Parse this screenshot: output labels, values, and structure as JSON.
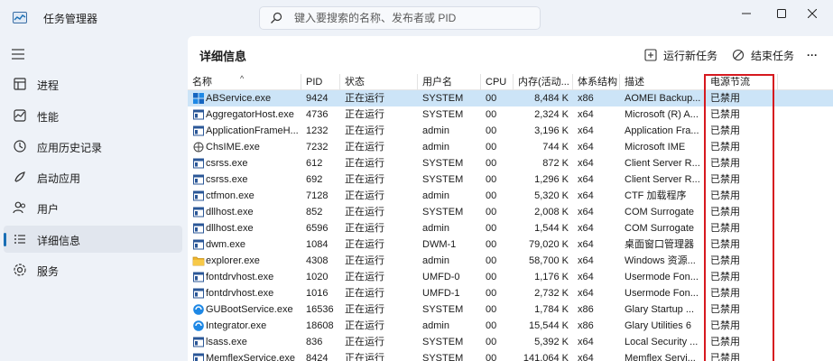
{
  "app": {
    "title": "任务管理器"
  },
  "search": {
    "placeholder": "键入要搜索的名称、发布者或 PID"
  },
  "sidebar": {
    "items": [
      {
        "label": "进程",
        "icon": "processes-icon"
      },
      {
        "label": "性能",
        "icon": "performance-icon"
      },
      {
        "label": "应用历史记录",
        "icon": "app-history-icon"
      },
      {
        "label": "启动应用",
        "icon": "startup-apps-icon"
      },
      {
        "label": "用户",
        "icon": "users-icon"
      },
      {
        "label": "详细信息",
        "icon": "details-icon",
        "active": true
      },
      {
        "label": "服务",
        "icon": "services-icon"
      }
    ]
  },
  "main": {
    "title": "详细信息",
    "run_new_task": "运行新任务",
    "end_task": "结束任务",
    "more": "···"
  },
  "table": {
    "columns": [
      "名称",
      "PID",
      "状态",
      "用户名",
      "CPU",
      "内存(活动...",
      "体系结构",
      "描述",
      "电源节流"
    ],
    "rows": [
      [
        "ABService.exe",
        "9424",
        "正在运行",
        "SYSTEM",
        "00",
        "8,484 K",
        "x86",
        "AOMEI Backup...",
        "已禁用"
      ],
      [
        "AggregatorHost.exe",
        "4736",
        "正在运行",
        "SYSTEM",
        "00",
        "2,324 K",
        "x64",
        "Microsoft (R) A...",
        "已禁用"
      ],
      [
        "ApplicationFrameH...",
        "1232",
        "正在运行",
        "admin",
        "00",
        "3,196 K",
        "x64",
        "Application Fra...",
        "已禁用"
      ],
      [
        "ChsIME.exe",
        "7232",
        "正在运行",
        "admin",
        "00",
        "744 K",
        "x64",
        "Microsoft IME",
        "已禁用"
      ],
      [
        "csrss.exe",
        "612",
        "正在运行",
        "SYSTEM",
        "00",
        "872 K",
        "x64",
        "Client Server R...",
        "已禁用"
      ],
      [
        "csrss.exe",
        "692",
        "正在运行",
        "SYSTEM",
        "00",
        "1,296 K",
        "x64",
        "Client Server R...",
        "已禁用"
      ],
      [
        "ctfmon.exe",
        "7128",
        "正在运行",
        "admin",
        "00",
        "5,320 K",
        "x64",
        "CTF 加载程序",
        "已禁用"
      ],
      [
        "dllhost.exe",
        "852",
        "正在运行",
        "SYSTEM",
        "00",
        "2,008 K",
        "x64",
        "COM Surrogate",
        "已禁用"
      ],
      [
        "dllhost.exe",
        "6596",
        "正在运行",
        "admin",
        "00",
        "1,544 K",
        "x64",
        "COM Surrogate",
        "已禁用"
      ],
      [
        "dwm.exe",
        "1084",
        "正在运行",
        "DWM-1",
        "00",
        "79,020 K",
        "x64",
        "桌面窗口管理器",
        "已禁用"
      ],
      [
        "explorer.exe",
        "4308",
        "正在运行",
        "admin",
        "00",
        "58,700 K",
        "x64",
        "Windows 资源...",
        "已禁用"
      ],
      [
        "fontdrvhost.exe",
        "1020",
        "正在运行",
        "UMFD-0",
        "00",
        "1,176 K",
        "x64",
        "Usermode Fon...",
        "已禁用"
      ],
      [
        "fontdrvhost.exe",
        "1016",
        "正在运行",
        "UMFD-1",
        "00",
        "2,732 K",
        "x64",
        "Usermode Fon...",
        "已禁用"
      ],
      [
        "GUBootService.exe",
        "16536",
        "正在运行",
        "SYSTEM",
        "00",
        "1,784 K",
        "x86",
        "Glary Startup ...",
        "已禁用"
      ],
      [
        "Integrator.exe",
        "18608",
        "正在运行",
        "admin",
        "00",
        "15,544 K",
        "x86",
        "Glary Utilities 6",
        "已禁用"
      ],
      [
        "lsass.exe",
        "836",
        "正在运行",
        "SYSTEM",
        "00",
        "5,392 K",
        "x64",
        "Local Security ...",
        "已禁用"
      ],
      [
        "MemflexService.exe",
        "8424",
        "正在运行",
        "SYSTEM",
        "00",
        "141,064 K",
        "x64",
        "Memflex Servi...",
        "已禁用"
      ]
    ],
    "icons": [
      "abservice-icon",
      "app-window-icon",
      "app-window-icon",
      "ime-icon",
      "app-window-icon",
      "app-window-icon",
      "app-window-icon",
      "app-window-icon",
      "app-window-icon",
      "app-window-icon",
      "folder-icon",
      "app-window-icon",
      "app-window-icon",
      "glary-icon",
      "glary-icon",
      "app-window-icon",
      "app-window-icon"
    ]
  },
  "colors": {
    "accent": "#1a6fb5",
    "selected_row": "#cce4f7",
    "highlight_outline": "#d6191f"
  }
}
